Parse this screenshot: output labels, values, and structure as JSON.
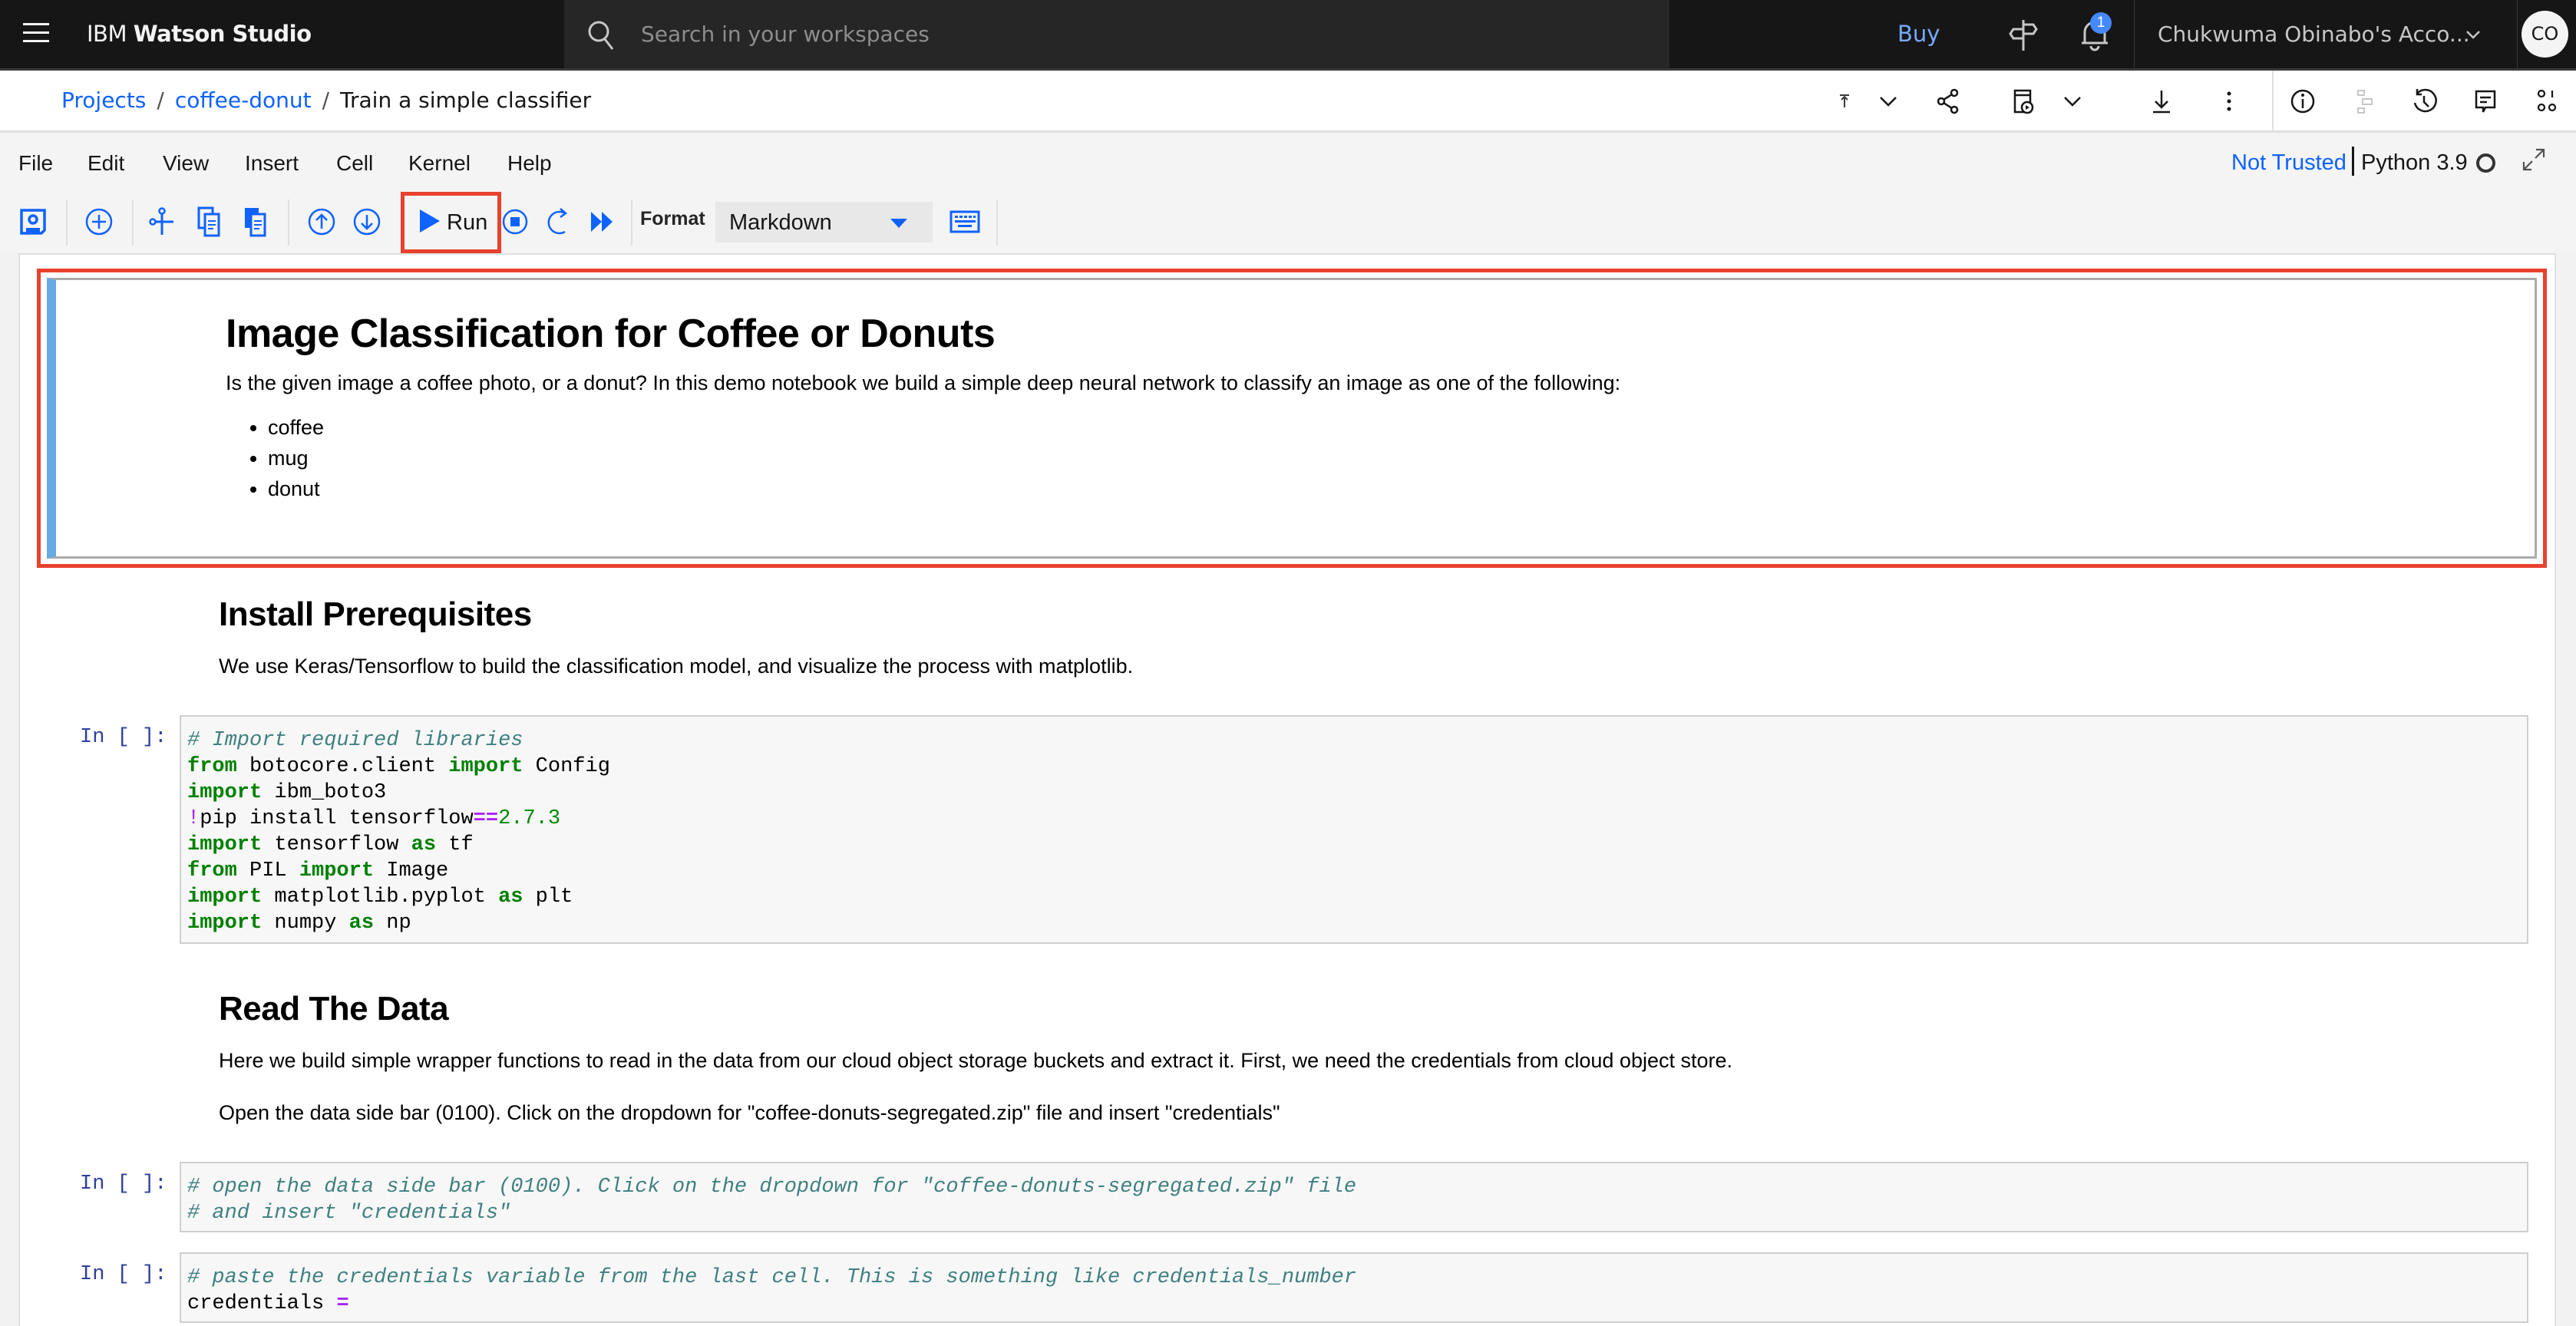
{
  "topnav": {
    "brand_prefix": "IBM",
    "brand_name": "Watson Studio",
    "search_placeholder": "Search in your workspaces",
    "buy_label": "Buy",
    "notification_count": "1",
    "account_label": "Chukwuma Obinabo's Acco...",
    "avatar_initials": "CO"
  },
  "breadcrumb": {
    "items": [
      "Projects",
      "coffee-donut"
    ],
    "current": "Train a simple classifier",
    "separator": "/"
  },
  "menubar": {
    "items": [
      "File",
      "Edit",
      "View",
      "Insert",
      "Cell",
      "Kernel",
      "Help"
    ],
    "trust_status": "Not Trusted",
    "kernel_name": "Python 3.9"
  },
  "toolbar": {
    "run_label": "Run",
    "format_label": "Format",
    "format_value": "Markdown"
  },
  "colors": {
    "accent": "#0f62fe",
    "highlight": "#e8412e",
    "selected_cell_bar": "#66aae6",
    "nav_bg": "#161616"
  },
  "notebook": {
    "cell1": {
      "title": "Image Classification for Coffee or Donuts",
      "text": "Is the given image a coffee photo, or a donut? In this demo notebook we build a simple deep neural network to classify an image as one of the following:",
      "list": [
        "coffee",
        "mug",
        "donut"
      ]
    },
    "cell2": {
      "title": "Install Prerequisites",
      "text": "We use Keras/Tensorflow to build the classification model, and visualize the process with matplotlib."
    },
    "code1": {
      "prompt": "In [ ]:",
      "comment": "# Import required libraries",
      "lines": [
        {
          "kw1": "from",
          "a": " botocore.client ",
          "kw2": "import",
          "b": " Config"
        },
        {
          "kw1": "import",
          "a": " ibm_boto3"
        },
        {
          "bang": "!",
          "a": "pip install tensorflow",
          "op": "==",
          "num": "2.7.3"
        },
        {
          "kw1": "import",
          "a": " tensorflow ",
          "kw2": "as",
          "b": " tf"
        },
        {
          "kw1": "from",
          "a": " PIL ",
          "kw2": "import",
          "b": " Image"
        },
        {
          "kw1": "import",
          "a": " matplotlib.pyplot ",
          "kw2": "as",
          "b": " plt"
        },
        {
          "kw1": "import",
          "a": " numpy ",
          "kw2": "as",
          "b": " np"
        }
      ]
    },
    "cell3": {
      "title": "Read The Data",
      "text1": "Here we build simple wrapper functions to read in the data from our cloud object storage buckets and extract it. First, we need the credentials from cloud object store.",
      "text2": "Open the data side bar (0100). Click on the dropdown for \"coffee-donuts-segregated.zip\" file and insert \"credentials\""
    },
    "code2": {
      "prompt": "In [ ]:",
      "line1": "# open the data side bar (0100). Click on the dropdown for \"coffee-donuts-segregated.zip\" file",
      "line2": "# and insert \"credentials\""
    },
    "code3": {
      "prompt": "In [ ]:",
      "line1": "# paste the credentials variable from the last cell. This is something like credentials_number",
      "var": "credentials",
      "op": "="
    }
  }
}
